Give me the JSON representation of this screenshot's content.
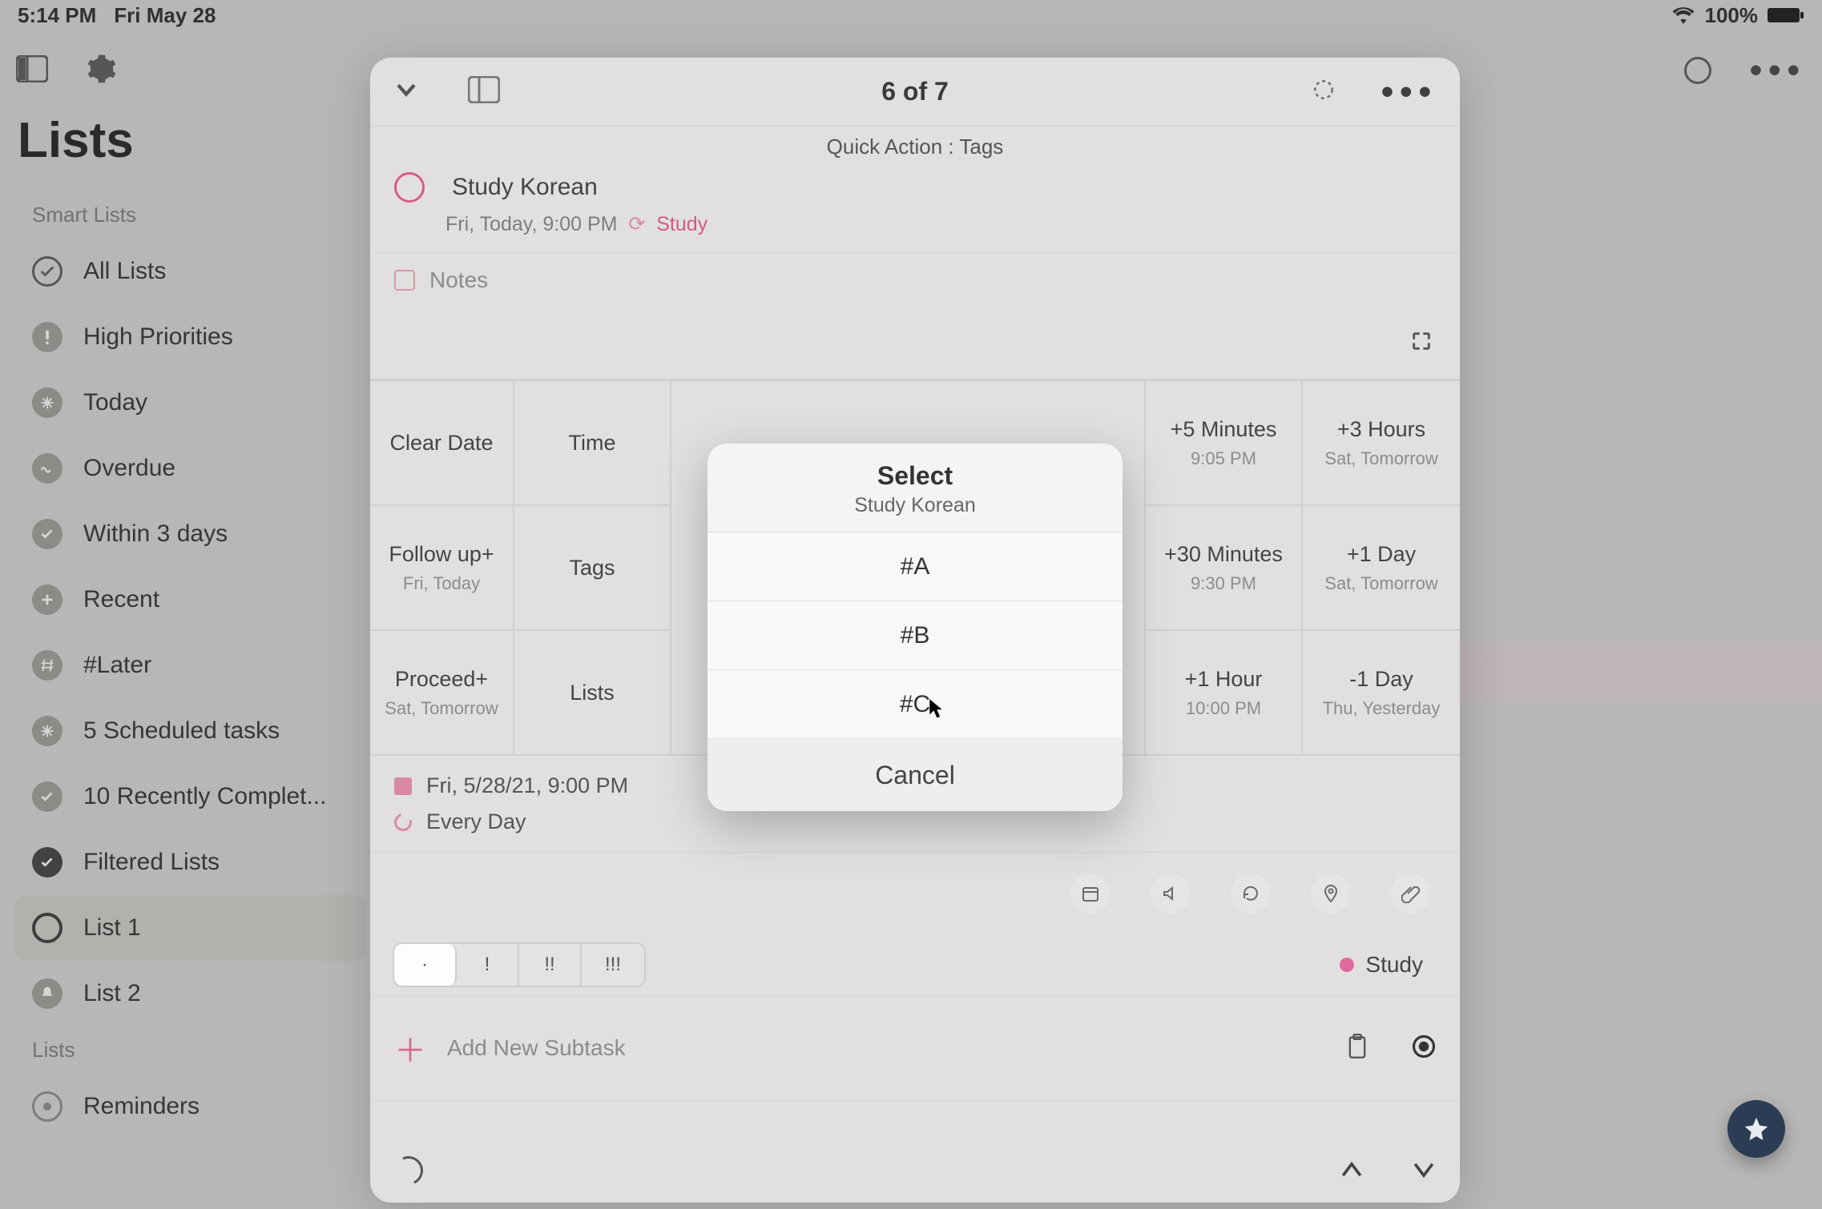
{
  "status": {
    "time": "5:14 PM",
    "date": "Fri May 28",
    "battery": "100%"
  },
  "sidebar": {
    "title": "Lists",
    "smart_label": "Smart Lists",
    "lists_label": "Lists",
    "items": [
      "All Lists",
      "High Priorities",
      "Today",
      "Overdue",
      "Within 3 days",
      "Recent",
      "#Later",
      "5 Scheduled tasks",
      "10 Recently Complet...",
      "Filtered Lists",
      "List 1",
      "List 2"
    ],
    "lists_items": [
      "Reminders"
    ]
  },
  "modal": {
    "counter": "6 of 7",
    "subtitle": "Quick Action : Tags",
    "task_title": "Study Korean",
    "task_meta": "Fri, Today, 9:00 PM",
    "task_tag": "Study",
    "notes_label": "Notes",
    "grid": {
      "clear": "Clear Date",
      "time": "Time",
      "tags": "Tags",
      "lists": "Lists",
      "followup": "Follow up+",
      "followup_sub": "Fri, Today",
      "proceed": "Proceed+",
      "proceed_sub": "Sat, Tomorrow",
      "p5m": "+5 Minutes",
      "p5m_sub": "9:05 PM",
      "p3h": "+3 Hours",
      "p3h_sub": "Sat, Tomorrow",
      "p30m": "+30 Minutes",
      "p30m_sub": "9:30 PM",
      "p1d": "+1 Day",
      "p1d_sub": "Sat, Tomorrow",
      "p1h": "+1 Hour",
      "p1h_sub": "10:00 PM",
      "m1d": "-1 Day",
      "m1d_sub": "Thu, Yesterday"
    },
    "sched_date": "Fri, 5/28/21, 9:00 PM",
    "repeat": "Every Day",
    "priority": {
      "p0": "·",
      "p1": "!",
      "p2": "!!",
      "p3": "!!!"
    },
    "list_chip": "Study",
    "subtask_placeholder": "Add New Subtask"
  },
  "sheet": {
    "title": "Select",
    "subtitle": "Study Korean",
    "options": [
      "#A",
      "#B",
      "#C"
    ],
    "cancel": "Cancel"
  }
}
